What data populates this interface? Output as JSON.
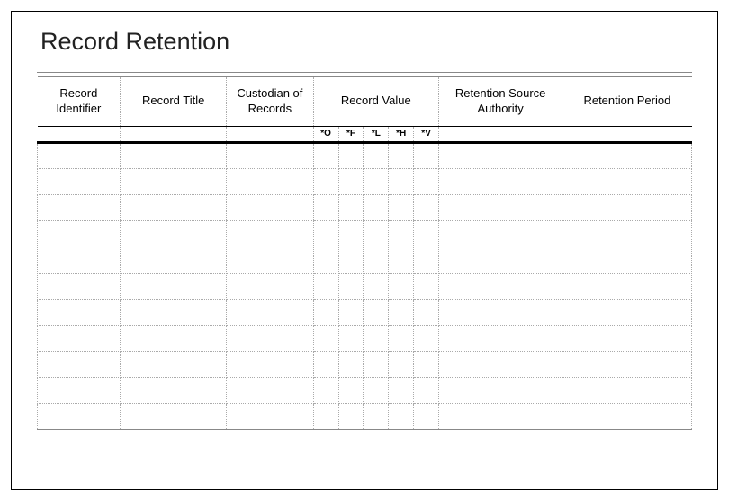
{
  "page_title": "Record Retention",
  "columns": {
    "record_identifier": "Record Identifier",
    "record_title": "Record Title",
    "custodian": "Custodian of Records",
    "record_value": "Record Value",
    "retention_source": "Retention Source Authority",
    "retention_period": "Retention Period"
  },
  "record_value_subcolumns": {
    "o": "*O",
    "f": "*F",
    "l": "*L",
    "h": "*H",
    "v": "*V"
  },
  "rows": [
    {
      "id": "",
      "title": "",
      "cust": "",
      "o": "",
      "f": "",
      "l": "",
      "h": "",
      "v": "",
      "src": "",
      "per": ""
    },
    {
      "id": "",
      "title": "",
      "cust": "",
      "o": "",
      "f": "",
      "l": "",
      "h": "",
      "v": "",
      "src": "",
      "per": ""
    },
    {
      "id": "",
      "title": "",
      "cust": "",
      "o": "",
      "f": "",
      "l": "",
      "h": "",
      "v": "",
      "src": "",
      "per": ""
    },
    {
      "id": "",
      "title": "",
      "cust": "",
      "o": "",
      "f": "",
      "l": "",
      "h": "",
      "v": "",
      "src": "",
      "per": ""
    },
    {
      "id": "",
      "title": "",
      "cust": "",
      "o": "",
      "f": "",
      "l": "",
      "h": "",
      "v": "",
      "src": "",
      "per": ""
    },
    {
      "id": "",
      "title": "",
      "cust": "",
      "o": "",
      "f": "",
      "l": "",
      "h": "",
      "v": "",
      "src": "",
      "per": ""
    },
    {
      "id": "",
      "title": "",
      "cust": "",
      "o": "",
      "f": "",
      "l": "",
      "h": "",
      "v": "",
      "src": "",
      "per": ""
    },
    {
      "id": "",
      "title": "",
      "cust": "",
      "o": "",
      "f": "",
      "l": "",
      "h": "",
      "v": "",
      "src": "",
      "per": ""
    },
    {
      "id": "",
      "title": "",
      "cust": "",
      "o": "",
      "f": "",
      "l": "",
      "h": "",
      "v": "",
      "src": "",
      "per": ""
    },
    {
      "id": "",
      "title": "",
      "cust": "",
      "o": "",
      "f": "",
      "l": "",
      "h": "",
      "v": "",
      "src": "",
      "per": ""
    },
    {
      "id": "",
      "title": "",
      "cust": "",
      "o": "",
      "f": "",
      "l": "",
      "h": "",
      "v": "",
      "src": "",
      "per": ""
    }
  ]
}
